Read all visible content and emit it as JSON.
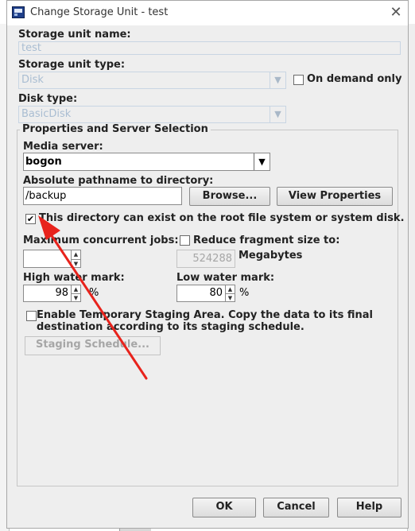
{
  "dialog": {
    "title": "Change Storage Unit - test",
    "storage_unit_name_label": "Storage unit name:",
    "storage_unit_name_value": "test",
    "storage_unit_type_label": "Storage unit type:",
    "storage_unit_type_value": "Disk",
    "on_demand_only_label": "On demand only",
    "disk_type_label": "Disk type:",
    "disk_type_value": "BasicDisk",
    "properties_group_title": "Properties and Server Selection",
    "media_server_label": "Media server:",
    "media_server_value": "bogon",
    "absolute_path_label": "Absolute pathname to directory:",
    "absolute_path_value": "/backup",
    "browse_button": "Browse...",
    "view_properties_button": "View Properties",
    "root_fs_checkbox_label": "This directory can exist on the root file system or system disk.",
    "root_fs_checked": true,
    "max_jobs_label": "Maximum concurrent jobs:",
    "max_jobs_value": "",
    "reduce_fragment_label": "Reduce fragment size to:",
    "fragment_size_value": "524288",
    "megabytes_label": "Megabytes",
    "high_water_label": "High water mark:",
    "high_water_value": "98",
    "high_water_unit": "%",
    "low_water_label": "Low water mark:",
    "low_water_value": "80",
    "low_water_unit": "%",
    "staging_label_line1": "Enable Temporary Staging Area.  Copy the data to its final",
    "staging_label_line2": "destination according to its staging schedule.",
    "staging_schedule_button": "Staging Schedule...",
    "ok_button": "OK",
    "cancel_button": "Cancel",
    "help_button": "Help"
  },
  "colors": {
    "annotation_arrow": "#e8231c",
    "disabled_text": "#a9bdd2",
    "dialog_bg": "#eeeeee"
  },
  "icons": {
    "window_icon": "app-window-icon",
    "close": "close-icon",
    "dropdown": "chevron-down-icon",
    "spin": "spinner-arrows-icon"
  }
}
